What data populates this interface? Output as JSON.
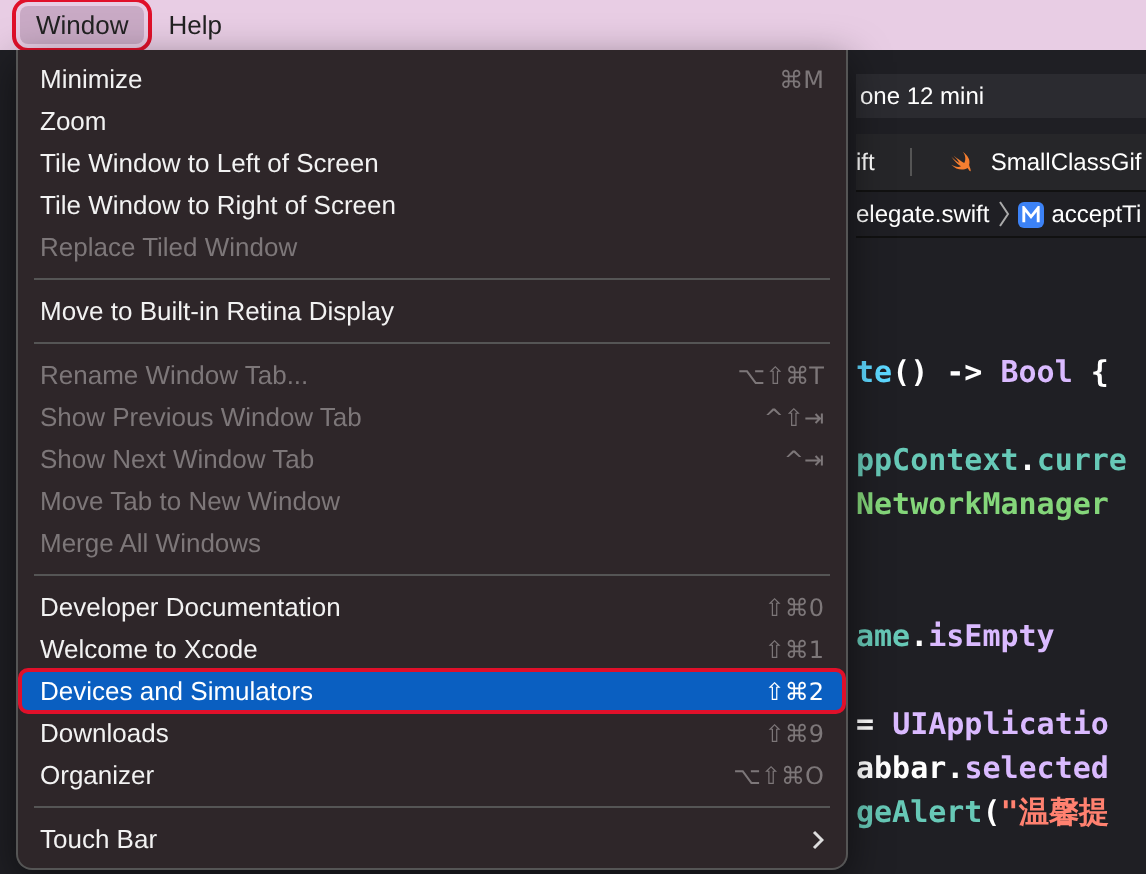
{
  "menu_bar": [
    {
      "label": "Window",
      "selected": true
    },
    {
      "label": "Help",
      "selected": false
    }
  ],
  "menu": [
    {
      "kind": "item",
      "label": "Minimize",
      "shortcut": "⌘M",
      "disabled": false,
      "selected": false
    },
    {
      "kind": "item",
      "label": "Zoom",
      "disabled": false,
      "selected": false
    },
    {
      "kind": "item",
      "label": "Tile Window to Left of Screen",
      "disabled": false,
      "selected": false
    },
    {
      "kind": "item",
      "label": "Tile Window to Right of Screen",
      "disabled": false,
      "selected": false
    },
    {
      "kind": "item",
      "label": "Replace Tiled Window",
      "disabled": true,
      "selected": false
    },
    {
      "kind": "separator"
    },
    {
      "kind": "item",
      "label": "Move to Built-in Retina Display",
      "disabled": false,
      "selected": false
    },
    {
      "kind": "separator"
    },
    {
      "kind": "item",
      "label": "Rename Window Tab...",
      "shortcut": "⌥⇧⌘T",
      "disabled": true,
      "selected": false
    },
    {
      "kind": "item",
      "label": "Show Previous Window Tab",
      "shortcut": "^⇧⇥",
      "disabled": true,
      "selected": false
    },
    {
      "kind": "item",
      "label": "Show Next Window Tab",
      "shortcut": "^⇥",
      "disabled": true,
      "selected": false
    },
    {
      "kind": "item",
      "label": "Move Tab to New Window",
      "disabled": true,
      "selected": false
    },
    {
      "kind": "item",
      "label": "Merge All Windows",
      "disabled": true,
      "selected": false
    },
    {
      "kind": "separator"
    },
    {
      "kind": "item",
      "label": "Developer Documentation",
      "shortcut": "⇧⌘0",
      "disabled": false,
      "selected": false
    },
    {
      "kind": "item",
      "label": "Welcome to Xcode",
      "shortcut": "⇧⌘1",
      "disabled": false,
      "selected": false
    },
    {
      "kind": "item",
      "label": "Devices and Simulators",
      "shortcut": "⇧⌘2",
      "disabled": false,
      "selected": true
    },
    {
      "kind": "item",
      "label": "Downloads",
      "shortcut": "⇧⌘9",
      "disabled": false,
      "selected": false
    },
    {
      "kind": "item",
      "label": "Organizer",
      "shortcut": "⌥⇧⌘O",
      "disabled": false,
      "selected": false
    },
    {
      "kind": "separator"
    },
    {
      "kind": "submenu",
      "label": "Touch Bar",
      "disabled": false,
      "selected": false
    }
  ],
  "editor": {
    "scheme": "one 12 mini",
    "tabs": [
      "ift",
      "SmallClassGif"
    ],
    "breadcrumb": [
      "elegate.swift",
      "acceptTi"
    ],
    "code": [
      {
        "tokens": [
          {
            "kind": "func",
            "text": "te"
          },
          {
            "kind": "plain",
            "text": "() -> "
          },
          {
            "kind": "type",
            "text": "Bool"
          },
          {
            "kind": "plain",
            "text": " {"
          }
        ]
      },
      {
        "tokens": [
          {
            "kind": "prop",
            "text": "ppContext"
          },
          {
            "kind": "plain",
            "text": "."
          },
          {
            "kind": "prop",
            "text": "curre"
          }
        ]
      },
      {
        "tokens": [
          {
            "kind": "class",
            "text": "NetworkManager"
          }
        ]
      },
      {
        "tokens": [
          {
            "kind": "prop",
            "text": "ame"
          },
          {
            "kind": "plain",
            "text": "."
          },
          {
            "kind": "type",
            "text": "isEmpty"
          }
        ]
      },
      {
        "tokens": [
          {
            "kind": "plain",
            "text": "= "
          },
          {
            "kind": "type",
            "text": "UIApplicatio"
          }
        ]
      },
      {
        "tokens": [
          {
            "kind": "plain",
            "text": "abbar."
          },
          {
            "kind": "type",
            "text": "selected"
          }
        ]
      },
      {
        "tokens": [
          {
            "kind": "prop",
            "text": "geAlert"
          },
          {
            "kind": "plain",
            "text": "("
          },
          {
            "kind": "string",
            "text": "\"温馨提"
          }
        ]
      }
    ]
  }
}
